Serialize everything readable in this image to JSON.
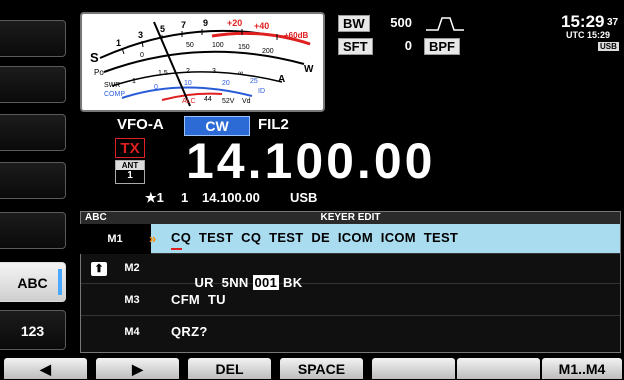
{
  "side_keys": [
    {
      "label": ""
    },
    {
      "label": ""
    },
    {
      "label": ""
    },
    {
      "label": ""
    },
    {
      "label": ""
    },
    {
      "label": "ABC",
      "active": true
    },
    {
      "label": "123"
    }
  ],
  "meter": {
    "s_label": "S",
    "po_label": "Po",
    "swr_label": "SWR",
    "comp_label": "COMP",
    "w_label": "W",
    "a_label": "A",
    "id_label": "ID",
    "alc_label": "ALC",
    "vd_label": "Vd",
    "s_scale": [
      "1",
      "3",
      "5",
      "7",
      "9",
      "+20",
      "+40",
      "+60dB"
    ],
    "po_scale": [
      "0",
      "50",
      "100",
      "150",
      "200"
    ],
    "swr_scale": [
      "1",
      "1.5",
      "2",
      "3",
      "∞"
    ],
    "comp_scale": [
      "0",
      "10",
      "20"
    ],
    "vd_scale": [
      "44",
      "52V"
    ],
    "id_scale": [
      "25"
    ]
  },
  "bw": {
    "label": "BW",
    "value": "500"
  },
  "sft": {
    "label": "SFT",
    "value": "0"
  },
  "bpf": "BPF",
  "clock": {
    "time": "15:29",
    "seconds": "37",
    "utc": "UTC 15:29",
    "mode": "USB"
  },
  "vfo": "VFO-A",
  "mode": "CW",
  "filter": "FIL2",
  "tx": "TX",
  "ant": {
    "label": "ANT",
    "num": "1"
  },
  "frequency": "14.100.00",
  "sub": {
    "star": "★1",
    "ch": "1",
    "freq": "14.100.00",
    "mode": "USB"
  },
  "keyer": {
    "tab": "ABC",
    "title": "KEYER EDIT",
    "rows": [
      {
        "label": "M1",
        "text": "CQ  TEST  CQ  TEST  DE  ICOM  ICOM  TEST",
        "selected": true
      },
      {
        "label": "M2",
        "text_pre": "UR  5NN ",
        "counter": "001",
        "text_post": " BK"
      },
      {
        "label": "M3",
        "text": "CFM  TU"
      },
      {
        "label": "M4",
        "text": "QRZ?"
      }
    ]
  },
  "fkeys": [
    "◀",
    "▶",
    "DEL",
    "SPACE",
    "",
    "",
    "M1..M4"
  ]
}
